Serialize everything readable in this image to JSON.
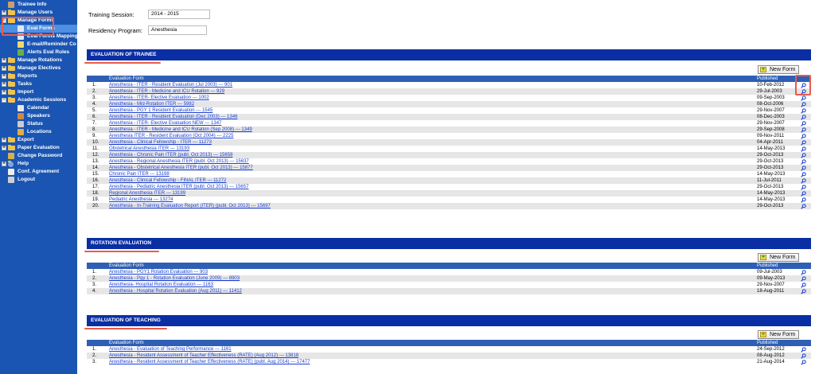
{
  "sidebar": {
    "items": [
      {
        "label": "Trainee Info",
        "kind": "top",
        "icon": "person-icon"
      },
      {
        "label": "Manage Users",
        "kind": "folder",
        "exp": "+"
      },
      {
        "label": "Manage Forms",
        "kind": "folder",
        "exp": "-"
      },
      {
        "label": "Eval Forms",
        "kind": "child",
        "icon": "form-icon",
        "selected": true
      },
      {
        "label": "Eval Forms Mapping",
        "kind": "child",
        "icon": "form-icon"
      },
      {
        "label": "E-mail/Reminder Co",
        "kind": "child",
        "icon": "email-icon"
      },
      {
        "label": "Alerts Eval Rules",
        "kind": "child",
        "icon": "alert-icon"
      },
      {
        "label": "Manage Rotations",
        "kind": "folder",
        "exp": "+"
      },
      {
        "label": "Manage Electives",
        "kind": "folder",
        "exp": "+"
      },
      {
        "label": "Reports",
        "kind": "folder",
        "exp": "+"
      },
      {
        "label": "Tasks",
        "kind": "folder",
        "exp": "+"
      },
      {
        "label": "Import",
        "kind": "folder",
        "exp": "+"
      },
      {
        "label": "Academic Sessions",
        "kind": "folder",
        "exp": "-"
      },
      {
        "label": "Calendar",
        "kind": "child",
        "icon": "calendar-icon"
      },
      {
        "label": "Speakers",
        "kind": "child",
        "icon": "speaker-icon"
      },
      {
        "label": "Status",
        "kind": "child",
        "icon": "status-icon"
      },
      {
        "label": "Locations",
        "kind": "child",
        "icon": "location-icon"
      },
      {
        "label": "Export",
        "kind": "folder",
        "exp": "+"
      },
      {
        "label": "Paper Evaluation",
        "kind": "folder",
        "exp": "+"
      },
      {
        "label": "Change Password",
        "kind": "top",
        "icon": "key-icon"
      },
      {
        "label": "Help",
        "kind": "folder",
        "exp": "+",
        "icon": "help-icon"
      },
      {
        "label": "Conf. Agreement",
        "kind": "top",
        "icon": "document-icon"
      },
      {
        "label": "Logout",
        "kind": "top",
        "icon": "logout-icon"
      }
    ]
  },
  "session": {
    "training_label": "Training Session:",
    "training_value": "2014 - 2015",
    "program_label": "Residency Program:",
    "program_value": "Anesthesia"
  },
  "sections": [
    {
      "title": "EVALUATION OF TRAINEE",
      "new_form": "New Form",
      "col_form": "Evaluation Form",
      "col_pub": "Published",
      "rows": [
        {
          "n": "1.",
          "name": "Anesthesia - ITER - Resident Evaluation (Jul 2003) --- 901",
          "date": "10-Feb-2012"
        },
        {
          "n": "2.",
          "name": "Anesthesia - ITER - Medicine and ICU Rotation --- 929",
          "date": "29-Jul-2003"
        },
        {
          "n": "3.",
          "name": "Anesthesia - ITER- Elective Evaluation --- 1002",
          "date": "09-Sep-2003"
        },
        {
          "n": "4.",
          "name": "Anesthesia - Mid-Rotation ITER --- 5982",
          "date": "08-Oct-2006"
        },
        {
          "n": "5.",
          "name": "Anesthesia - PGY 1 Resident Evaluation --- 1545",
          "date": "29-Nov-2007"
        },
        {
          "n": "6.",
          "name": "Anesthesia - ITER - Resident Evaluation (Dec 2003) --- 1346",
          "date": "08-Dec-2003"
        },
        {
          "n": "7.",
          "name": "Anesthesia - ITER- Elective Evaluation NEW --- 1347",
          "date": "29-Nov-2007"
        },
        {
          "n": "8.",
          "name": "Anesthesia - ITER - Medicine and ICU Rotation (Sep 2008) --- 1349",
          "date": "29-Sep-2008"
        },
        {
          "n": "9.",
          "name": "Anesthesia ITER - Resident Evaluation (Oct 2004) --- 2225",
          "date": "09-Nov-2011"
        },
        {
          "n": "10.",
          "name": "Anesthesia - Clinical Fellowship - ITER --- 11273",
          "date": "04-Apr-2011"
        },
        {
          "n": "11.",
          "name": "Obstetrical Anesthesia ITER --- 13193",
          "date": "14-May-2013"
        },
        {
          "n": "12.",
          "name": "Anesthesia - Chronic Pain ITER (publ. Oct 2013) --- 15658",
          "date": "29-Oct-2013"
        },
        {
          "n": "13.",
          "name": "Anesthesia - Regional Anesthesia ITER (publ. Oct 2013) --- 15637",
          "date": "29-Oct-2013"
        },
        {
          "n": "14.",
          "name": "Anesthesia - Obstetrical Anesthesia ITER (publ. Oct 2013) --- 15877",
          "date": "29-Oct-2013"
        },
        {
          "n": "15.",
          "name": "Chronic Pain ITER --- 13198",
          "date": "14-May-2013"
        },
        {
          "n": "16.",
          "name": "Anesthesia - Clinical Fellowship - FINAL ITER --- 11272",
          "date": "11-Jul-2011"
        },
        {
          "n": "17.",
          "name": "Anesthesia - Pediatric Anesthesia ITER (publ. Oct 2013) --- 15657",
          "date": "29-Oct-2013"
        },
        {
          "n": "18.",
          "name": "Regional Anesthesia ITER --- 13199",
          "date": "14-May-2013"
        },
        {
          "n": "19.",
          "name": "Pediatric Anesthesia --- 13274",
          "date": "14-May-2013"
        },
        {
          "n": "20.",
          "name": "Anesthesia - In-Training Evaluation Report (ITER) (publ. Oct 2013) --- 15697",
          "date": "29-Oct-2013"
        }
      ]
    },
    {
      "title": "ROTATION EVALUATION",
      "new_form": "New Form",
      "col_form": "Evaluation Form",
      "col_pub": "Published",
      "rows": [
        {
          "n": "1.",
          "name": "Anesthesia - PGY1 Rotation Evaluation --- 903",
          "date": "09-Jul-2003"
        },
        {
          "n": "2.",
          "name": "Anesthesia - Pgy 1 - Rotation Evaluation (June 2009) --- 8903",
          "date": "09-May-2013"
        },
        {
          "n": "3.",
          "name": "Anesthesia- Hospital Rotation Evaluation --- 1163",
          "date": "29-Nov-2007"
        },
        {
          "n": "4.",
          "name": "Anesthesia - Hospital Rotation Evaluation (Aug 2011) --- 11412",
          "date": "18-Aug-2011"
        }
      ]
    },
    {
      "title": "EVALUATION OF TEACHING",
      "new_form": "New Form",
      "col_form": "Evaluation Form",
      "col_pub": "Published",
      "rows": [
        {
          "n": "1.",
          "name": "Anesthesia - Evaluation of Teaching Performance --- 1161",
          "date": "24-Sep-2012"
        },
        {
          "n": "2.",
          "name": "Anesthesia - Resident Assessment of Teacher Effectiveness (RATE) (Aug 2012) --- 13818",
          "date": "08-Aug-2012"
        },
        {
          "n": "3.",
          "name": "Anesthesia - Resident Assessment of Teacher Effectiveness (RATE) (publ. Aug 2014) --- 17477",
          "date": "21-Aug-2014"
        }
      ]
    }
  ],
  "colors": {
    "sidebar_bg": "#1a55b3",
    "section_bar": "#0a2ea3",
    "table_header": "#2e5fb5",
    "link": "#1a3fd0",
    "annotation": "#e85c4a"
  }
}
